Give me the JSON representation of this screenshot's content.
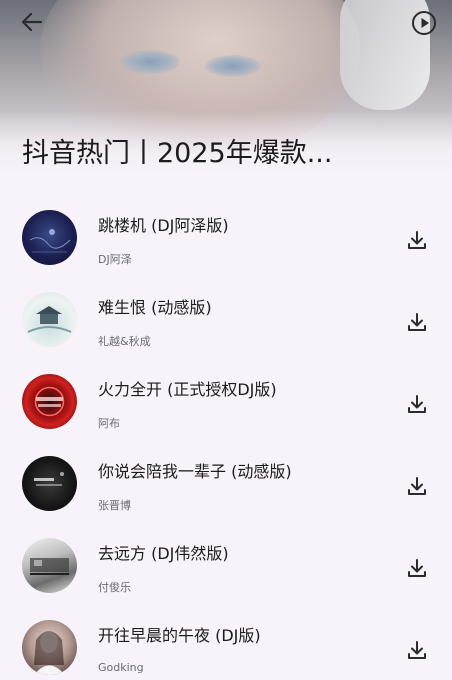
{
  "header": {
    "title": "抖音热门丨2025年爆款..."
  },
  "songs": [
    {
      "title": "跳楼机 (DJ阿泽版)",
      "artist": "DJ阿泽"
    },
    {
      "title": "难生恨 (动感版)",
      "artist": "礼越&秋成"
    },
    {
      "title": "火力全开 (正式授权DJ版)",
      "artist": "阿布"
    },
    {
      "title": "你说会陪我一辈子 (动感版)",
      "artist": "张晋博"
    },
    {
      "title": "去远方 (DJ伟然版)",
      "artist": "付俊乐"
    },
    {
      "title": "开往早晨的午夜 (DJ版)",
      "artist": "Godking"
    }
  ],
  "icons": {
    "back": "arrow-left",
    "play": "play-circle",
    "download": "download"
  },
  "colors": {
    "background": "#f8f2fa",
    "text": "#1c1b1f",
    "subtext": "#6d6a72"
  }
}
